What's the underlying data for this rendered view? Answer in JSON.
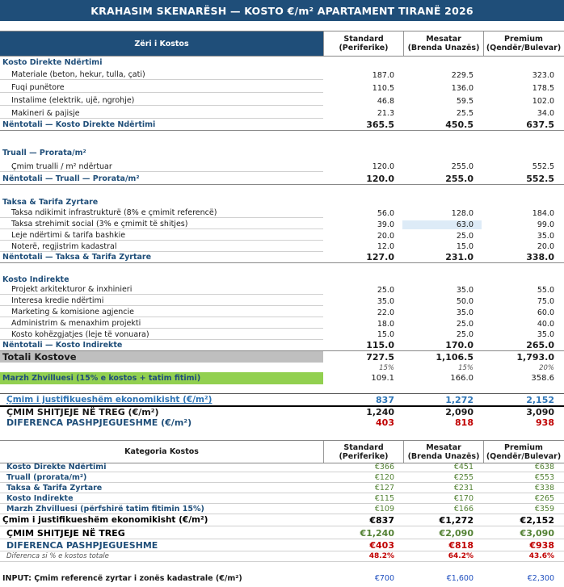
{
  "title": "KRAHASIM SKENARËSH — KOSTO €/m² APARTAMENT TIRANË 2026",
  "columns": {
    "label": "Zëri i Kostos",
    "c1": [
      "Standard",
      "(Periferike)"
    ],
    "c2": [
      "Mesatar",
      "(Brenda Unazës)"
    ],
    "c3": [
      "Premium",
      "(Qendër/Bulevar)"
    ]
  },
  "s1": {
    "title": "Kosto Direkte Ndërtimi",
    "items": [
      {
        "label": "Materiale (beton, hekur, tulla, çati)",
        "v": [
          "187.0",
          "229.5",
          "323.0"
        ]
      },
      {
        "label": "Fuqi punëtore",
        "v": [
          "110.5",
          "136.0",
          "178.5"
        ]
      },
      {
        "label": "Instalime (elektrik, ujë, ngrohje)",
        "v": [
          "46.8",
          "59.5",
          "102.0"
        ]
      },
      {
        "label": "Makineri & pajisje",
        "v": [
          "21.3",
          "25.5",
          "34.0"
        ]
      }
    ],
    "subtotal": {
      "label": "Nëntotali — Kosto Direkte Ndërtimi",
      "v": [
        "365.5",
        "450.5",
        "637.5"
      ]
    }
  },
  "s2": {
    "title": "Truall — Prorata/m²",
    "items": [
      {
        "label": "Çmim trualli / m² ndërtuar",
        "v": [
          "120.0",
          "255.0",
          "552.5"
        ]
      }
    ],
    "subtotal": {
      "label": "Nëntotali — Truall — Prorata/m²",
      "v": [
        "120.0",
        "255.0",
        "552.5"
      ]
    }
  },
  "s3": {
    "title": "Taksa & Tarifa Zyrtare",
    "items": [
      {
        "label": "Taksa ndikimit infrastrukturë (8% e çmimit referencë)",
        "v": [
          "56.0",
          "128.0",
          "184.0"
        ]
      },
      {
        "label": "Taksa strehimit social (3% e çmimit të shitjes)",
        "v": [
          "39.0",
          "63.0",
          "99.0"
        ]
      },
      {
        "label": "Leje ndërtimi & tarifa bashkie",
        "v": [
          "20.0",
          "25.0",
          "35.0"
        ]
      },
      {
        "label": "Noterë, regjistrim kadastral",
        "v": [
          "12.0",
          "15.0",
          "20.0"
        ]
      }
    ],
    "subtotal": {
      "label": "Nëntotali — Taksa & Tarifa Zyrtare",
      "v": [
        "127.0",
        "231.0",
        "338.0"
      ]
    }
  },
  "s4": {
    "title": "Kosto Indirekte",
    "items": [
      {
        "label": "Projekt arkitekturor & inxhinieri",
        "v": [
          "25.0",
          "35.0",
          "55.0"
        ]
      },
      {
        "label": "Interesa kredie ndërtimi",
        "v": [
          "35.0",
          "50.0",
          "75.0"
        ]
      },
      {
        "label": "Marketing & komisione agjencie",
        "v": [
          "22.0",
          "35.0",
          "60.0"
        ]
      },
      {
        "label": "Administrim & menaxhim projekti",
        "v": [
          "18.0",
          "25.0",
          "40.0"
        ]
      },
      {
        "label": "Kosto kohëzgjatjes (leje të vonuara)",
        "v": [
          "15.0",
          "25.0",
          "35.0"
        ]
      }
    ],
    "subtotal": {
      "label": "Nëntotali — Kosto Indirekte",
      "v": [
        "115.0",
        "170.0",
        "265.0"
      ]
    }
  },
  "total": {
    "label": "Totali Kostove",
    "v": [
      "727.5",
      "1,106.5",
      "1,793.0"
    ]
  },
  "pcts": [
    "15%",
    "15%",
    "20%"
  ],
  "margin": {
    "label": "Marzh Zhvilluesi (15% e kostos + tatim fitimi)",
    "v": [
      "109.1",
      "166.0",
      "358.6"
    ]
  },
  "just": {
    "label": "Çmim i justifikueshëm ekonomikisht (€/m²)",
    "v": [
      "837",
      "1,272",
      "2,152"
    ]
  },
  "market": {
    "label": "ÇMIM SHITJEJE NË TREG (€/m²)",
    "v": [
      "1,240",
      "2,090",
      "3,090"
    ]
  },
  "diff": {
    "label": "DIFERENCA PASHPJEGUESHME (€/m²)",
    "v": [
      "403",
      "818",
      "938"
    ]
  },
  "summary": {
    "header": "Kategoria Kostos",
    "rows": [
      {
        "label": "Kosto Direkte Ndërtimi",
        "v": [
          "€366",
          "€451",
          "€638"
        ]
      },
      {
        "label": "Truall (prorata/m²)",
        "v": [
          "€120",
          "€255",
          "€553"
        ]
      },
      {
        "label": "Taksa & Tarifa Zyrtare",
        "v": [
          "€127",
          "€231",
          "€338"
        ]
      },
      {
        "label": "Kosto Indirekte",
        "v": [
          "€115",
          "€170",
          "€265"
        ]
      },
      {
        "label": "Marzh Zhvilluesi (përfshirë tatim fitimin 15%)",
        "v": [
          "€109",
          "€166",
          "€359"
        ]
      }
    ],
    "just": {
      "label": "Çmim i justifikueshëm ekonomikisht (€/m²)",
      "v": [
        "€837",
        "€1,272",
        "€2,152"
      ]
    },
    "market": {
      "label": "ÇMIM SHITJEJE NË TREG",
      "v": [
        "€1,240",
        "€2,090",
        "€3,090"
      ]
    },
    "diff": {
      "label": "DIFERENCA PASHPJEGUESHME",
      "v": [
        "€403",
        "€818",
        "€938"
      ]
    },
    "diffpct": {
      "label": "Diferenca si % e kostos totale",
      "v": [
        "48.2%",
        "64.2%",
        "43.6%"
      ]
    }
  },
  "input": {
    "label": "INPUT: Çmim referencë zyrtar i zonës kadastrale (€/m²)",
    "v": [
      "€700",
      "€1,600",
      "€2,300"
    ]
  }
}
